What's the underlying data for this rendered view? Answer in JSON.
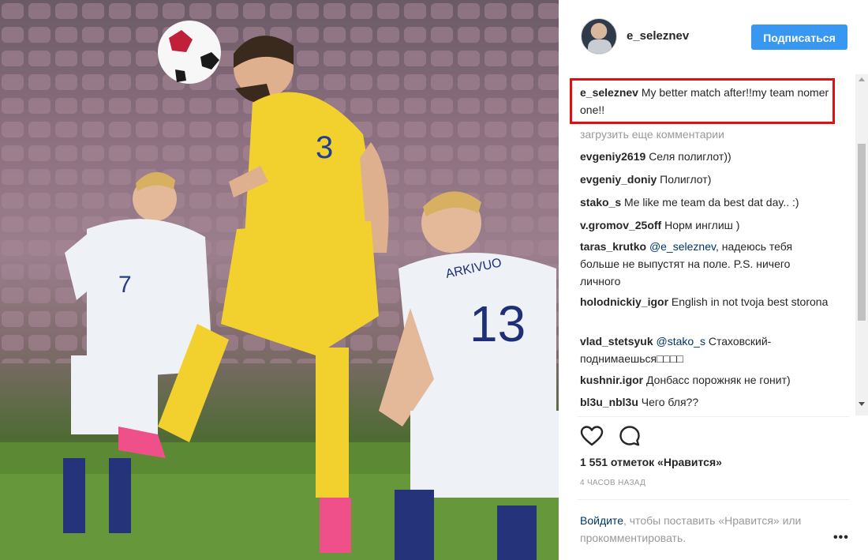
{
  "post": {
    "username": "e_seleznev",
    "follow_label": "Подписаться",
    "caption": {
      "user": "e_seleznev",
      "text": "My better match after!!my team nomer one!!"
    },
    "load_more_label": "загрузить еще комментарии",
    "comments": [
      {
        "user": "evgeniy2619",
        "text": "Селя полиглот))"
      },
      {
        "user": "evgeniy_doniy",
        "text": "Полиглот)"
      },
      {
        "user": "stako_s",
        "text": "Me like me team da best dat day.. :)"
      },
      {
        "user": "v.gromov_25off",
        "text": "Норм инглиш )"
      },
      {
        "user": "taras_krutko",
        "mention": "@e_seleznev",
        "text": ", надеюсь тебя больше не выпустят на поле. P.S. ничего личного"
      },
      {
        "user": "holodnickiy_igor",
        "text": "English in not tvoja best storona"
      },
      {
        "user": "vlad_stetsyuk",
        "mention": "@stako_s",
        "text": " Стаховский- поднимаешься□□□□"
      },
      {
        "user": "kushnir.igor",
        "text": "Донбасс порожняк не гонит)"
      },
      {
        "user": "bl3u_nbl3u",
        "text": "Чего бля??"
      }
    ],
    "likes_label": "1 551 отметок «Нравится»",
    "timestamp": "4 ЧАСОВ НАЗАД",
    "login_link": "Войдите",
    "login_text": ", чтобы поставить «Нравится» или прокомментировать.",
    "more_label": "•••"
  },
  "photo": {
    "jersey_numbers": [
      "7",
      "13"
    ],
    "jersey_name": "ARKIVUO"
  },
  "colors": {
    "accent": "#3897f0",
    "highlight_border": "#e01010",
    "link": "#003569",
    "muted": "#999999"
  },
  "icons": [
    "heart-icon",
    "comment-icon",
    "more-options-icon",
    "scroll-up-arrow-icon",
    "scroll-down-arrow-icon"
  ]
}
